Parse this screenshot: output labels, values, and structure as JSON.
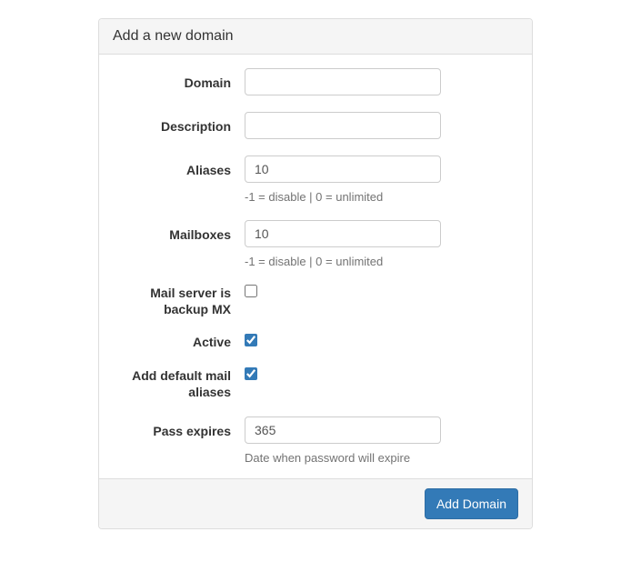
{
  "panel": {
    "title": "Add a new domain"
  },
  "form": {
    "domain": {
      "label": "Domain",
      "value": ""
    },
    "description": {
      "label": "Description",
      "value": ""
    },
    "aliases": {
      "label": "Aliases",
      "value": "10",
      "help": "-1 = disable | 0 = unlimited"
    },
    "mailboxes": {
      "label": "Mailboxes",
      "value": "10",
      "help": "-1 = disable | 0 = unlimited"
    },
    "backup_mx": {
      "label": "Mail server is backup MX",
      "checked": false
    },
    "active": {
      "label": "Active",
      "checked": true
    },
    "default_aliases": {
      "label": "Add default mail aliases",
      "checked": true
    },
    "pass_expires": {
      "label": "Pass expires",
      "value": "365",
      "help": "Date when password will expire"
    }
  },
  "footer": {
    "submit_label": "Add Domain"
  }
}
